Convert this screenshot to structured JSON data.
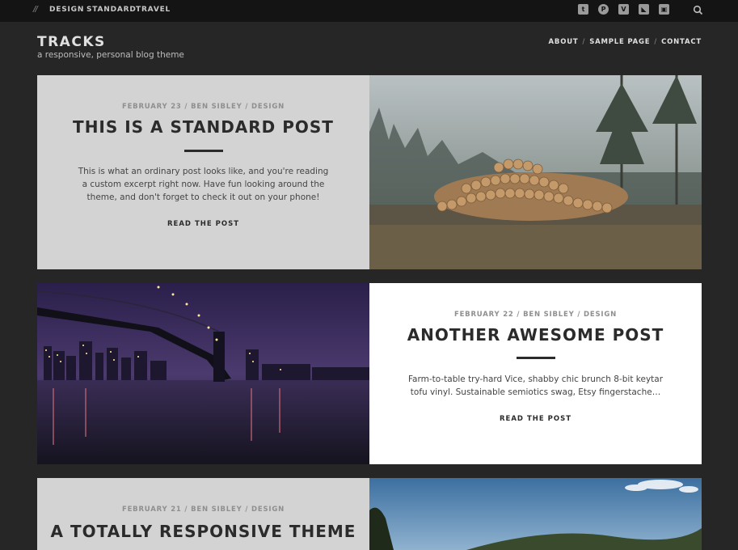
{
  "topbar": {
    "slashes": "//",
    "categories": [
      "DESIGN",
      "STANDARD",
      "TRAVEL"
    ],
    "social_icons": [
      "twitter-icon",
      "pinterest-icon",
      "vimeo-icon",
      "rss-icon",
      "instagram-icon"
    ],
    "social_glyphs": [
      "t",
      "P",
      "V",
      "◣",
      "▣"
    ]
  },
  "header": {
    "title": "TRACKS",
    "tagline": "a responsive, personal blog theme",
    "nav": [
      "ABOUT",
      "SAMPLE PAGE",
      "CONTACT"
    ],
    "nav_sep": "/"
  },
  "posts": [
    {
      "meta": "FEBRUARY 23 / BEN SIBLEY / DESIGN",
      "title": "THIS IS A STANDARD POST",
      "excerpt": "This is what an ordinary post looks like, and you're reading a custom excerpt right now. Have fun looking around the theme, and don't forget to check it out on your phone!",
      "read_more": "READ THE POST"
    },
    {
      "meta": "FEBRUARY 22 / BEN SIBLEY / DESIGN",
      "title": "ANOTHER AWESOME POST",
      "excerpt": "Farm-to-table try-hard Vice, shabby chic brunch 8-bit keytar tofu vinyl. Sustainable semiotics swag, Etsy fingerstache…",
      "read_more": "READ THE POST"
    },
    {
      "meta": "FEBRUARY 21 / BEN SIBLEY / DESIGN",
      "title": "A TOTALLY RESPONSIVE THEME"
    }
  ]
}
